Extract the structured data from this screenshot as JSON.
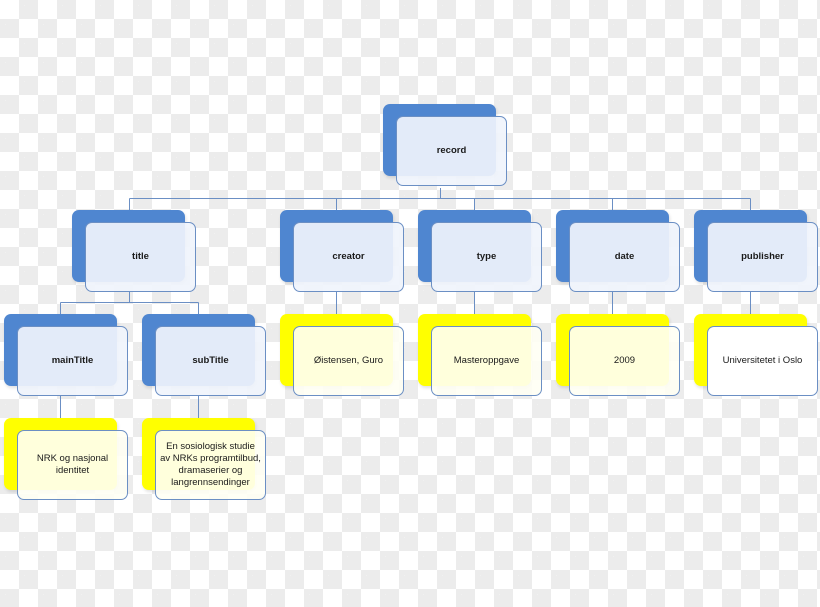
{
  "diagram": {
    "type": "hierarchy-tree",
    "colors": {
      "category_fill": "#4f86d0",
      "value_fill": "#ffff00",
      "connector": "#6b8fc4"
    },
    "root": {
      "label": "record"
    },
    "level1": [
      {
        "id": "title",
        "label": "title"
      },
      {
        "id": "creator",
        "label": "creator"
      },
      {
        "id": "type",
        "label": "type"
      },
      {
        "id": "date",
        "label": "date"
      },
      {
        "id": "publisher",
        "label": "publisher"
      }
    ],
    "title_children": [
      {
        "id": "mainTitle",
        "label": "mainTitle"
      },
      {
        "id": "subTitle",
        "label": "subTitle"
      }
    ],
    "values": {
      "mainTitle": "NRK og nasjonal identitet",
      "subTitle": "En sosiologisk studie av NRKs programtilbud, dramaserier og langrennsendinger",
      "creator": "Øistensen, Guro",
      "type": "Masteroppgave",
      "date": "2009",
      "publisher": "Universitetet i Oslo"
    }
  }
}
